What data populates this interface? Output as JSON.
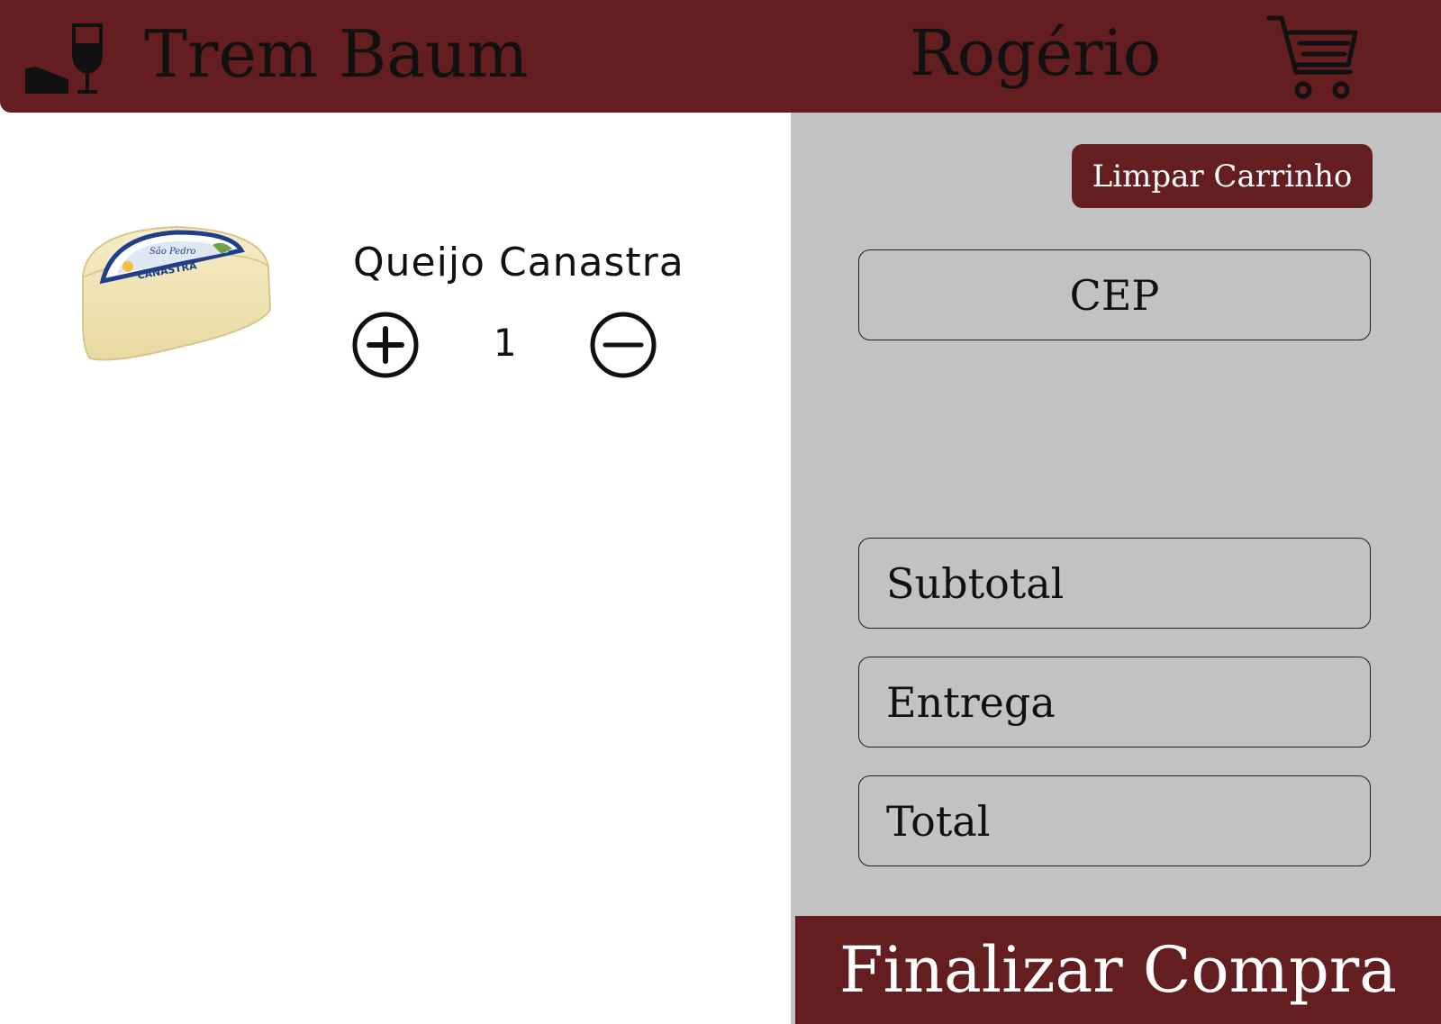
{
  "header": {
    "brand": "Trem Baum",
    "user_name": "Rogério",
    "logo_icon": "wine-glass-cheese-icon",
    "cart_icon": "shopping-cart-icon"
  },
  "cart": {
    "items": [
      {
        "name": "Queijo Canastra",
        "quantity": "1",
        "image_icon": "cheese-wheel-image",
        "image_label_text": "CANASTRA",
        "image_brand_text": "São Pedro"
      }
    ]
  },
  "summary": {
    "clear_cart_label": "Limpar Carrinho",
    "cep_placeholder": "CEP",
    "subtotal_label": "Subtotal",
    "delivery_label": "Entrega",
    "total_label": "Total",
    "checkout_label": "Finalizar Compra"
  },
  "colors": {
    "brand": "#641e20",
    "panel": "#c2c2c2",
    "background": "#ffffff"
  }
}
